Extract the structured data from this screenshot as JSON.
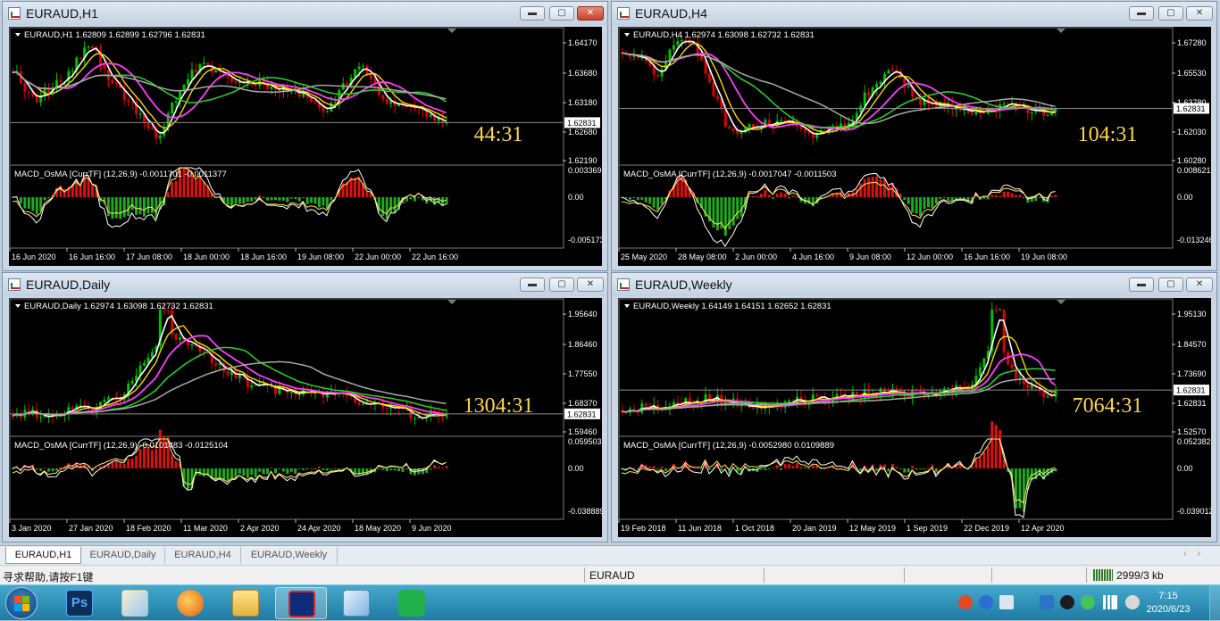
{
  "windows": [
    {
      "id": "h1",
      "title": "EURAUD,H1",
      "active": true,
      "price_caption": "EURAUD,H1  1.62809 1.62899 1.62796 1.62831",
      "osc_caption": "MACD_OsMA [CurrTF] (12,26,9) -0.0011701 -0.0011377",
      "countdown": "44:31",
      "current_price": "1.62831",
      "price_axis": [
        "1.64170",
        "1.63680",
        "1.63180",
        "1.62680",
        "1.62190"
      ],
      "osc_axis": [
        "0.0033698",
        "0.00",
        "-0.0051736"
      ],
      "time_axis": [
        "16 Jun 2020",
        "16 Jun 16:00",
        "17 Jun 08:00",
        "18 Jun 00:00",
        "18 Jun 16:00",
        "19 Jun 08:00",
        "22 Jun 00:00",
        "22 Jun 16:00"
      ]
    },
    {
      "id": "h4",
      "title": "EURAUD,H4",
      "active": false,
      "price_caption": "EURAUD,H4  1.62974 1.63098 1.62732 1.62831",
      "osc_caption": "MACD_OsMA [CurrTF] (12,26,9) -0.0017047 -0.0011503",
      "countdown": "104:31",
      "current_price": "1.62831",
      "price_axis": [
        "1.67280",
        "1.65530",
        "1.63780",
        "1.62030",
        "1.60280"
      ],
      "osc_axis": [
        "0.0086217",
        "0.00",
        "-0.0132465"
      ],
      "time_axis": [
        "25 May 2020",
        "28 May 08:00",
        "2 Jun 00:00",
        "4 Jun 16:00",
        "9 Jun 08:00",
        "12 Jun 00:00",
        "16 Jun 16:00",
        "19 Jun 08:00"
      ]
    },
    {
      "id": "d1",
      "title": "EURAUD,Daily",
      "active": false,
      "price_caption": "EURAUD,Daily  1.62974 1.63098 1.62732 1.62831",
      "osc_caption": "MACD_OsMA [CurrTF] (12,26,9) -0.0101483 -0.0125104",
      "countdown": "1304:31",
      "current_price": "1.62831",
      "price_axis": [
        "1.95640",
        "1.86460",
        "1.77550",
        "1.68370",
        "1.59460"
      ],
      "osc_axis": [
        "0.0595038",
        "0.00",
        "-0.038889"
      ],
      "time_axis": [
        "3 Jan 2020",
        "27 Jan 2020",
        "18 Feb 2020",
        "11 Mar 2020",
        "2 Apr 2020",
        "24 Apr 2020",
        "18 May 2020",
        "9 Jun 2020"
      ]
    },
    {
      "id": "w1",
      "title": "EURAUD,Weekly",
      "active": false,
      "price_caption": "EURAUD,Weekly  1.64149 1.64151 1.62652 1.62831",
      "osc_caption": "MACD_OsMA [CurrTF] (12,26,9) -0.0052980 0.0109889",
      "countdown": "7064:31",
      "current_price": "1.62831",
      "price_axis": [
        "1.95130",
        "1.84570",
        "1.73690",
        "1.62831",
        "1.52570"
      ],
      "osc_axis": [
        "0.0523829",
        "0.00",
        "-0.039012"
      ],
      "time_axis": [
        "19 Feb 2018",
        "11 Jun 2018",
        "1 Oct 2018",
        "20 Jan 2019",
        "12 May 2019",
        "1 Sep 2019",
        "22 Dec 2019",
        "12 Apr 2020"
      ]
    }
  ],
  "tabs": [
    "EURAUD,H1",
    "EURAUD,Daily",
    "EURAUD,H4",
    "EURAUD,Weekly"
  ],
  "active_tab": 0,
  "status_bar": {
    "help_text": "寻求帮助,请按F1键",
    "profile": "EURAUD",
    "traffic": "2999/3 kb"
  },
  "clock": {
    "time": "7:15",
    "date": "2020/6/23"
  },
  "window_controls": {
    "minimize": "▬",
    "maximize": "▢",
    "close": "✕"
  },
  "colors": {
    "chart_bg": "#000000",
    "bull_candle": "#00c000",
    "bear_candle": "#e00000",
    "ma_fast": "#ffffff",
    "ma_mid": "#ffd700",
    "ma_slow": "#ff3bff",
    "ma_long": "#27d627",
    "ma_longest": "#a9a9a9",
    "countdown": "#ffd84a",
    "axis_text": "#ffffff"
  },
  "taskbar_apps": [
    "start-orb",
    "photoshop",
    "paint",
    "firefox",
    "file-explorer",
    "metatrader",
    "notepad",
    "wechat"
  ]
}
